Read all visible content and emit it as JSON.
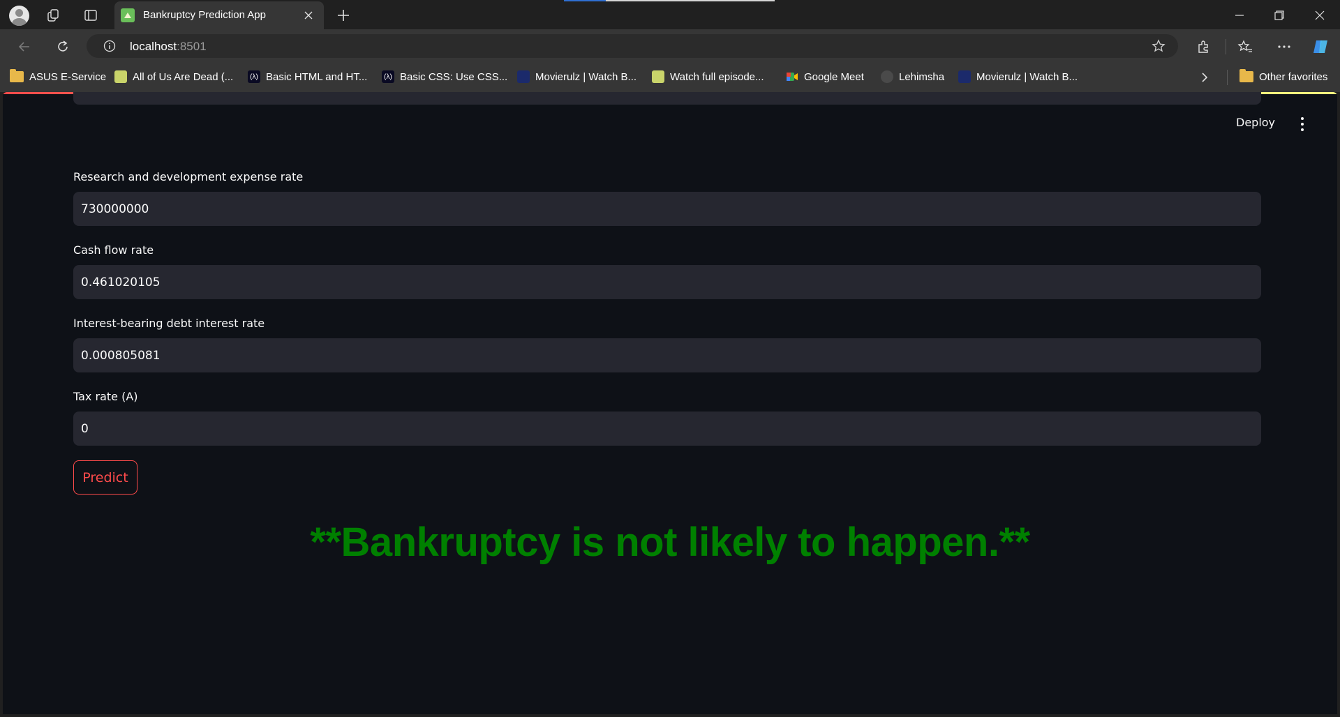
{
  "browser": {
    "tab_title": "Bankruptcy Prediction App",
    "url_host": "localhost",
    "url_port": ":8501",
    "bookmarks": [
      {
        "label": "ASUS E-Service",
        "icon": "folder-icon"
      },
      {
        "label": "All of Us Are Dead (...",
        "icon": "site-icon"
      },
      {
        "label": "Basic HTML and HT...",
        "icon": "freecodecamp-icon"
      },
      {
        "label": "Basic CSS: Use CSS...",
        "icon": "freecodecamp-icon"
      },
      {
        "label": "Movierulz | Watch B...",
        "icon": "movierulz-icon"
      },
      {
        "label": "Watch full episode...",
        "icon": "site-icon"
      },
      {
        "label": "Google Meet",
        "icon": "google-meet-icon"
      },
      {
        "label": "Lehimsha",
        "icon": "github-icon"
      },
      {
        "label": "Movierulz | Watch B...",
        "icon": "movierulz-icon"
      }
    ],
    "other_favorites": "Other favorites"
  },
  "app": {
    "deploy_label": "Deploy",
    "fields": [
      {
        "label": "Research and development expense rate",
        "value": "730000000"
      },
      {
        "label": "Cash flow rate",
        "value": "0.461020105"
      },
      {
        "label": "Interest-bearing debt interest rate",
        "value": "0.000805081"
      },
      {
        "label": "Tax rate (A)",
        "value": "0"
      }
    ],
    "predict_label": "Predict",
    "result_text": "**Bankruptcy is not likely to happen.**",
    "result_color": "#008000",
    "accent_color": "#ff4b4b"
  }
}
